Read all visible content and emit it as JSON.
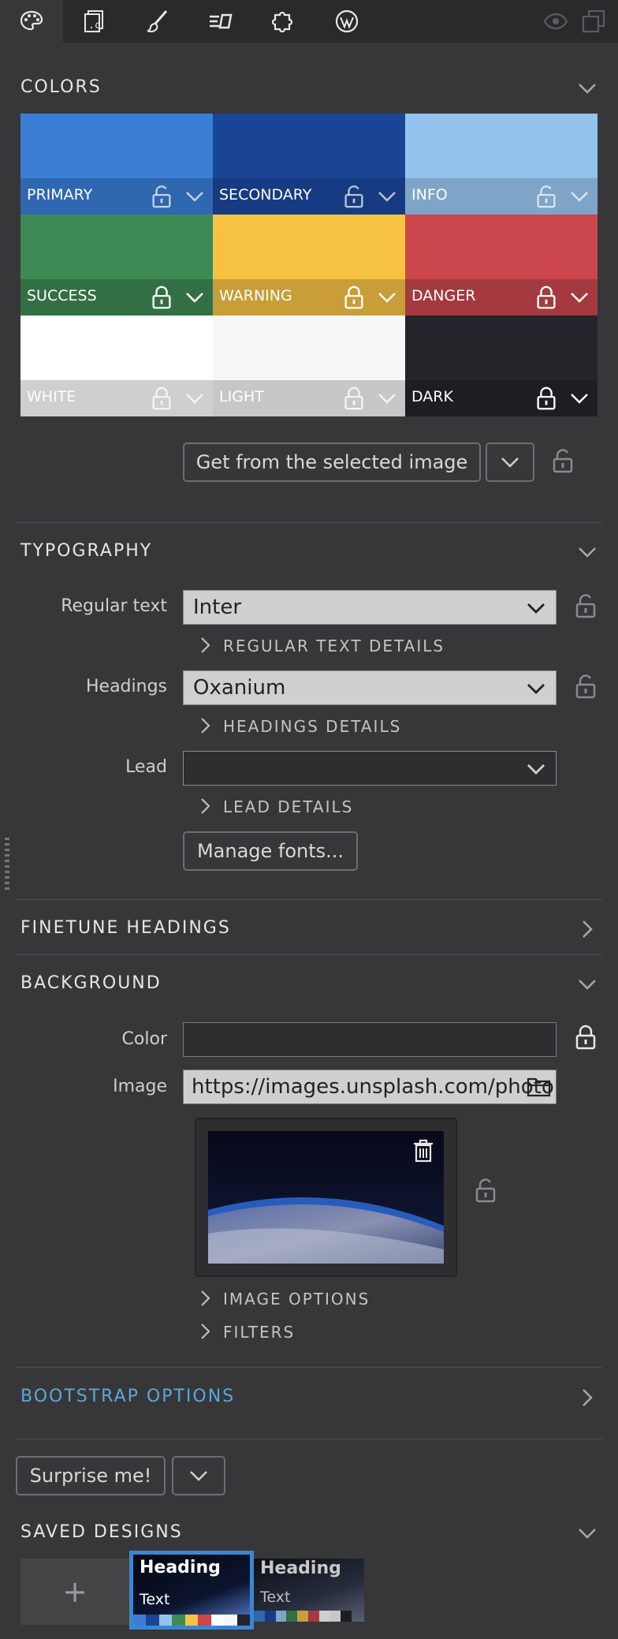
{
  "toolbar": {
    "icons": [
      "palette-icon",
      "code-file-icon",
      "brush-icon",
      "text-layout-icon",
      "puzzle-icon",
      "wordpress-icon",
      "eye-icon",
      "duplicate-icon"
    ]
  },
  "colors": {
    "title": "COLORS",
    "swatches": [
      {
        "label": "PRIMARY",
        "color": "#3a7fd5",
        "bar": "#2f67b0",
        "locked": false
      },
      {
        "label": "SECONDARY",
        "color": "#1a4494",
        "bar": "#163b82",
        "locked": false
      },
      {
        "label": "INFO",
        "color": "#93c3ec",
        "bar": "#7ea5c8",
        "locked": false
      },
      {
        "label": "SUCCESS",
        "color": "#3e8a55",
        "bar": "#336f45",
        "locked": true
      },
      {
        "label": "WARNING",
        "color": "#f7c244",
        "bar": "#c99d37",
        "locked": true
      },
      {
        "label": "DANGER",
        "color": "#cb464d",
        "bar": "#a43a3f",
        "locked": true
      },
      {
        "label": "WHITE",
        "color": "#ffffff",
        "bar": "#cfcfcf",
        "locked": true
      },
      {
        "label": "LIGHT",
        "color": "#f6f7f9",
        "bar": "#c6c7c9",
        "locked": true
      },
      {
        "label": "DARK",
        "color": "#23252a",
        "bar": "#1c1e22",
        "locked": true
      }
    ],
    "get_button": "Get from the selected image"
  },
  "typography": {
    "title": "TYPOGRAPHY",
    "regular_label": "Regular text",
    "regular_value": "Inter",
    "regular_details": "REGULAR TEXT DETAILS",
    "headings_label": "Headings",
    "headings_value": "Oxanium",
    "headings_details": "HEADINGS DETAILS",
    "lead_label": "Lead",
    "lead_value": "",
    "lead_details": "LEAD DETAILS",
    "manage_button": "Manage fonts..."
  },
  "finetune": {
    "title": "FINETUNE HEADINGS"
  },
  "background": {
    "title": "BACKGROUND",
    "color_label": "Color",
    "color_value": "",
    "image_label": "Image",
    "image_value": "https://images.unsplash.com/photo",
    "image_options": "IMAGE OPTIONS",
    "filters": "FILTERS"
  },
  "bootstrap": {
    "title": "BOOTSTRAP OPTIONS",
    "accent": "#5aa8d8"
  },
  "surprise": {
    "label": "Surprise me!"
  },
  "saved": {
    "title": "SAVED DESIGNS",
    "add": "+",
    "designs": [
      {
        "heading": "Heading",
        "text": "Text",
        "selected": true
      },
      {
        "heading": "Heading",
        "text": "Text",
        "selected": false
      }
    ]
  }
}
